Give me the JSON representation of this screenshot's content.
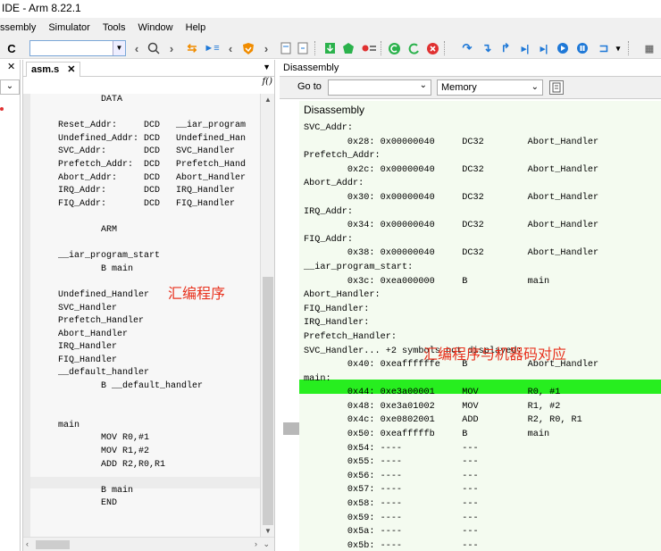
{
  "window": {
    "title": "IDE - Arm 8.22.1"
  },
  "menu": [
    "ssembly",
    "Simulator",
    "Tools",
    "Window",
    "Help"
  ],
  "toolbar": {
    "left_glyph": "C",
    "brand_colors": {
      "green": "#2bb24c",
      "red": "#e03131",
      "blue": "#1e78d7",
      "orange": "#f08c00"
    }
  },
  "left_panel": {
    "close": "✕",
    "collapse": "⌄"
  },
  "editor": {
    "tab_label": "asm.s",
    "tab_close": "✕",
    "func_glyph": "f()",
    "lines": [
      "        DATA",
      "",
      "Reset_Addr:     DCD   __iar_program",
      "Undefined_Addr: DCD   Undefined_Han",
      "SVC_Addr:       DCD   SVC_Handler",
      "Prefetch_Addr:  DCD   Prefetch_Hand",
      "Abort_Addr:     DCD   Abort_Handler",
      "IRQ_Addr:       DCD   IRQ_Handler",
      "FIQ_Addr:       DCD   FIQ_Handler",
      "",
      "        ARM",
      "",
      "__iar_program_start",
      "        B main",
      "",
      "Undefined_Handler",
      "SVC_Handler",
      "Prefetch_Handler",
      "Abort_Handler",
      "IRQ_Handler",
      "FIQ_Handler",
      "__default_handler",
      "        B __default_handler",
      "",
      "",
      "main",
      "        MOV R0,#1",
      "        MOV R1,#2",
      "        ADD R2,R0,R1",
      "",
      "        B main",
      "        END"
    ],
    "annotation": "汇编程序"
  },
  "disassembly": {
    "panel_title": "Disassembly",
    "goto_label": "Go to",
    "goto_value": "",
    "memory_label": "Memory",
    "listing_title": "Disassembly",
    "rows": [
      "SVC_Addr:",
      "        0x28: 0x00000040     DC32        Abort_Handler",
      "Prefetch_Addr:",
      "        0x2c: 0x00000040     DC32        Abort_Handler",
      "Abort_Addr:",
      "        0x30: 0x00000040     DC32        Abort_Handler",
      "IRQ_Addr:",
      "        0x34: 0x00000040     DC32        Abort_Handler",
      "FIQ_Addr:",
      "        0x38: 0x00000040     DC32        Abort_Handler",
      "__iar_program_start:",
      "        0x3c: 0xea000000     B           main",
      "Abort_Handler:",
      "FIQ_Handler:",
      "IRQ_Handler:",
      "Prefetch_Handler:",
      "SVC_Handler... +2 symbols not displayed:",
      "        0x40: 0xeaffffffe    B           Abort_Handler",
      "main:",
      "        0x44: 0xe3a00001     MOV         R0, #1",
      "        0x48: 0xe3a01002     MOV         R1, #2",
      "        0x4c: 0xe0802001     ADD         R2, R0, R1",
      "        0x50: 0xeafffffb     B           main",
      "        0x54: ----           ---",
      "        0x55: ----           ---",
      "        0x56: ----           ---",
      "        0x57: ----           ---",
      "        0x58: ----           ---",
      "        0x59: ----           ---",
      "        0x5a: ----           ---",
      "        0x5b: ----           ---"
    ],
    "annotation": "汇编程序与机器码对应"
  }
}
